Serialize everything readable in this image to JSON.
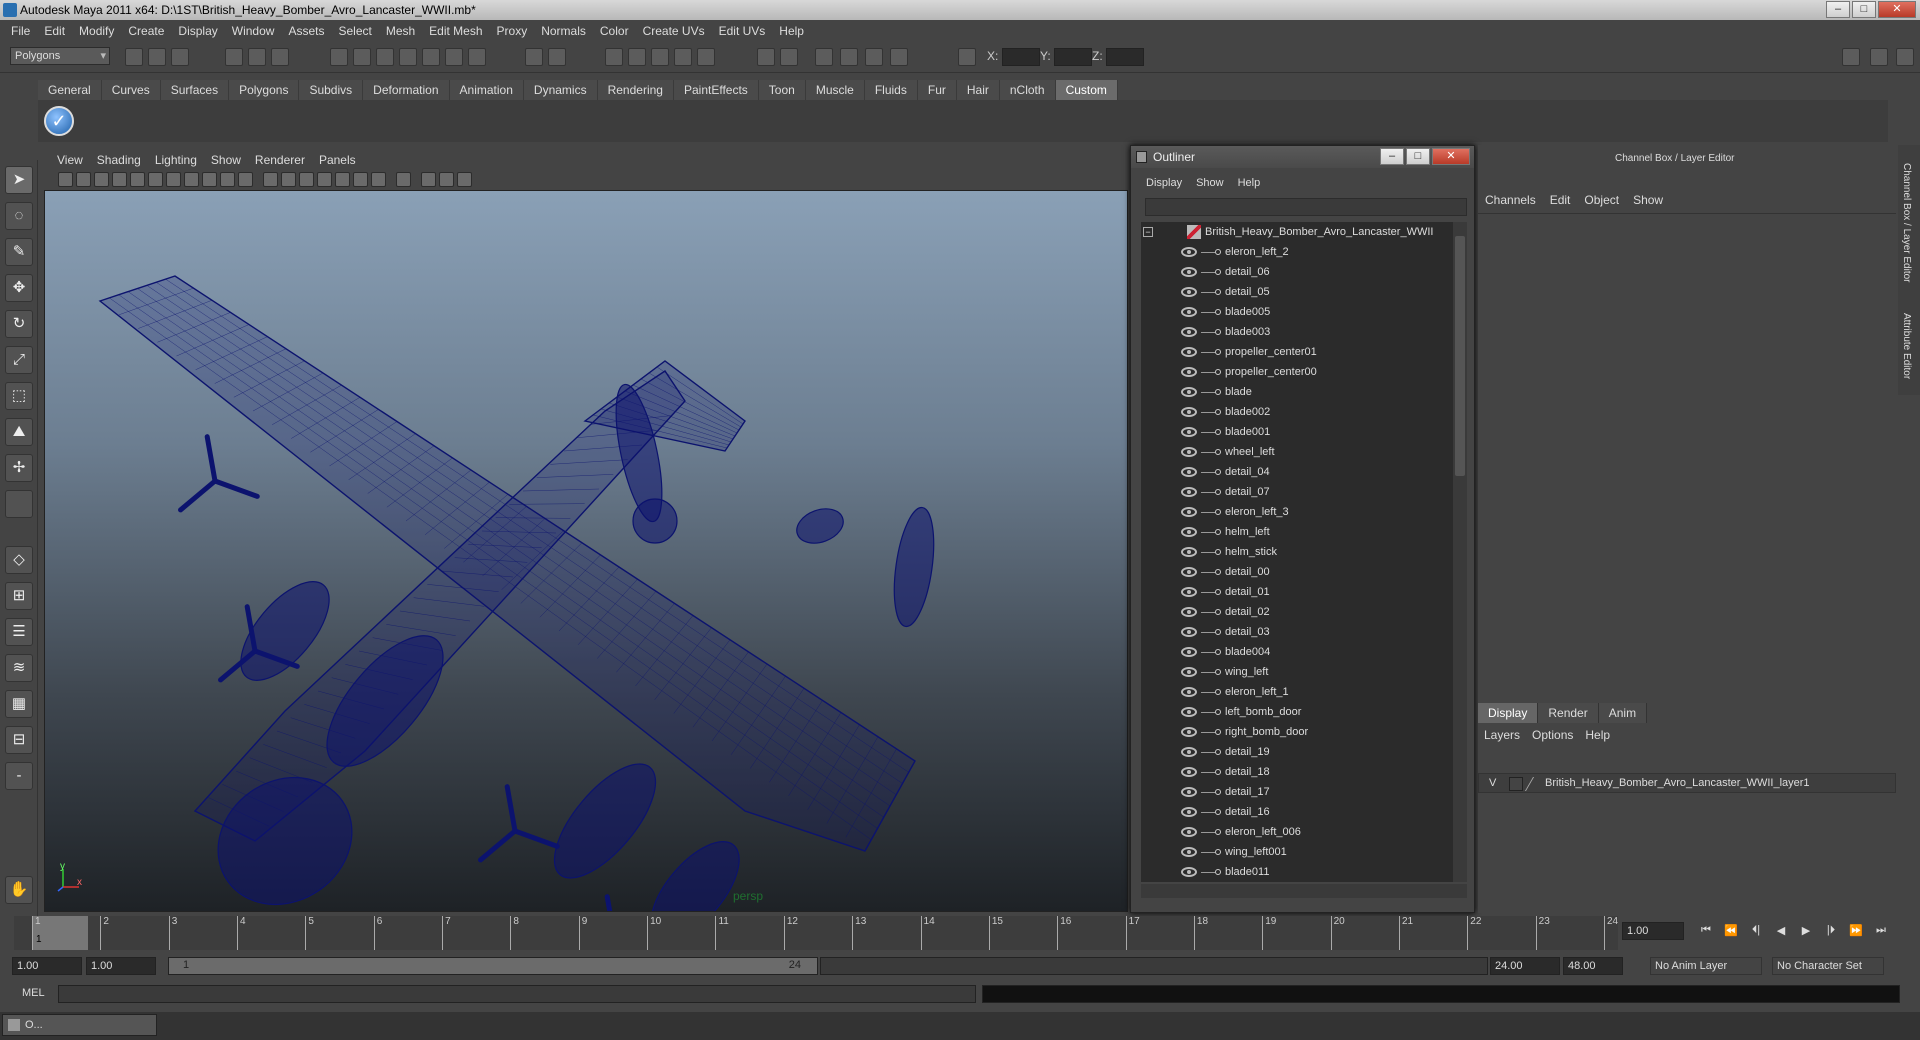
{
  "app": {
    "title": "Autodesk Maya 2011 x64: D:\\1ST\\British_Heavy_Bomber_Avro_Lancaster_WWII.mb*"
  },
  "window_controls": {
    "minimize": "–",
    "maximize": "□",
    "close": "✕"
  },
  "menubar": [
    "File",
    "Edit",
    "Modify",
    "Create",
    "Display",
    "Window",
    "Assets",
    "Select",
    "Mesh",
    "Edit Mesh",
    "Proxy",
    "Normals",
    "Color",
    "Create UVs",
    "Edit UVs",
    "Help"
  ],
  "statusline": {
    "mode": "Polygons",
    "x_label": "X:",
    "y_label": "Y:",
    "z_label": "Z:"
  },
  "shelf_tabs": [
    "General",
    "Curves",
    "Surfaces",
    "Polygons",
    "Subdivs",
    "Deformation",
    "Animation",
    "Dynamics",
    "Rendering",
    "PaintEffects",
    "Toon",
    "Muscle",
    "Fluids",
    "Fur",
    "Hair",
    "nCloth",
    "Custom"
  ],
  "shelf_active": "Custom",
  "viewport": {
    "menu": [
      "View",
      "Shading",
      "Lighting",
      "Show",
      "Renderer",
      "Panels"
    ],
    "camera_label": "persp",
    "axis_y": "y",
    "axis_x": "x",
    "wire_color": "#0c136e"
  },
  "outliner": {
    "title": "Outliner",
    "menu": [
      "Display",
      "Show",
      "Help"
    ],
    "root": "British_Heavy_Bomber_Avro_Lancaster_WWII",
    "items": [
      "eleron_left_2",
      "detail_06",
      "detail_05",
      "blade005",
      "blade003",
      "propeller_center01",
      "propeller_center00",
      "blade",
      "blade002",
      "blade001",
      "wheel_left",
      "detail_04",
      "detail_07",
      "eleron_left_3",
      "helm_left",
      "helm_stick",
      "detail_00",
      "detail_01",
      "detail_02",
      "detail_03",
      "blade004",
      "wing_left",
      "eleron_left_1",
      "left_bomb_door",
      "right_bomb_door",
      "detail_19",
      "detail_18",
      "detail_17",
      "detail_16",
      "eleron_left_006",
      "wing_left001",
      "blade011"
    ]
  },
  "channel_box": {
    "title": "Channel Box / Layer Editor",
    "menu": [
      "Channels",
      "Edit",
      "Object",
      "Show"
    ],
    "layer_tabs": [
      "Display",
      "Render",
      "Anim"
    ],
    "layer_active": "Display",
    "layer_menu": [
      "Layers",
      "Options",
      "Help"
    ],
    "layer": {
      "visible": "V",
      "name": "British_Heavy_Bomber_Avro_Lancaster_WWII_layer1"
    },
    "side_tabs": [
      "Channel Box / Layer Editor",
      "Attribute Editor"
    ]
  },
  "time_slider": {
    "frames": [
      "1",
      "2",
      "3",
      "4",
      "5",
      "6",
      "7",
      "8",
      "9",
      "10",
      "11",
      "12",
      "13",
      "14",
      "15",
      "16",
      "17",
      "18",
      "19",
      "20",
      "21",
      "22",
      "23",
      "24"
    ],
    "current": "1",
    "current_field": "1.00"
  },
  "playback": [
    "⏮",
    "⏪",
    "⏴|",
    "◀",
    "▶",
    "|⏵",
    "⏩",
    "⏭"
  ],
  "range": {
    "start": "1.00",
    "playback_start": "1.00",
    "slider_start": "1",
    "slider_end": "24",
    "playback_end": "24.00",
    "end": "48.00",
    "anim_layer": "No Anim Layer",
    "character_set": "No Character Set"
  },
  "command_line": {
    "label": "MEL"
  },
  "taskbar": {
    "item": "O..."
  }
}
